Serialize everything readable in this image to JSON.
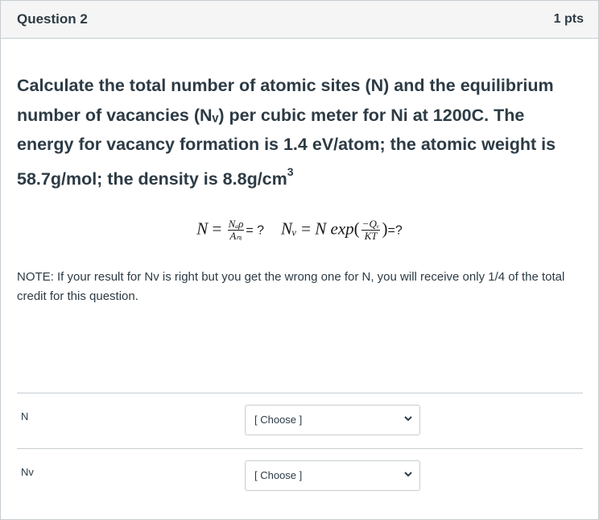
{
  "question": {
    "title": "Question 2",
    "points": "1 pts",
    "prompt_text": "Calculate the total number of atomic sites (N) and the equilibrium number of vacancies (Nᵥ) per cubic meter for Ni at 1200C. The energy for vacancy formation is 1.4 eV/atom; the atomic weight is 58.7g/mol; the density is 8.8g/cm",
    "prompt_superscript": "3"
  },
  "formula": {
    "n_lhs": "N",
    "equals": "=",
    "n_num": "Nₐρ",
    "n_den": "Aₙᵢ",
    "n_q": "= ?",
    "nv_lhs": "Nᵥ",
    "nv_rhs": "N exp",
    "exp_num": "−Qᵥ",
    "exp_den": "KT",
    "nv_q": "=?"
  },
  "note": "NOTE: If your result for Nv is right but you get the wrong one for N, you will receive only 1/4 of the total credit for this question.",
  "answers": [
    {
      "label": "N",
      "selected": "[ Choose ]"
    },
    {
      "label": "Nv",
      "selected": "[ Choose ]"
    }
  ],
  "icons": {
    "dropdown": "chevron-down-icon"
  }
}
